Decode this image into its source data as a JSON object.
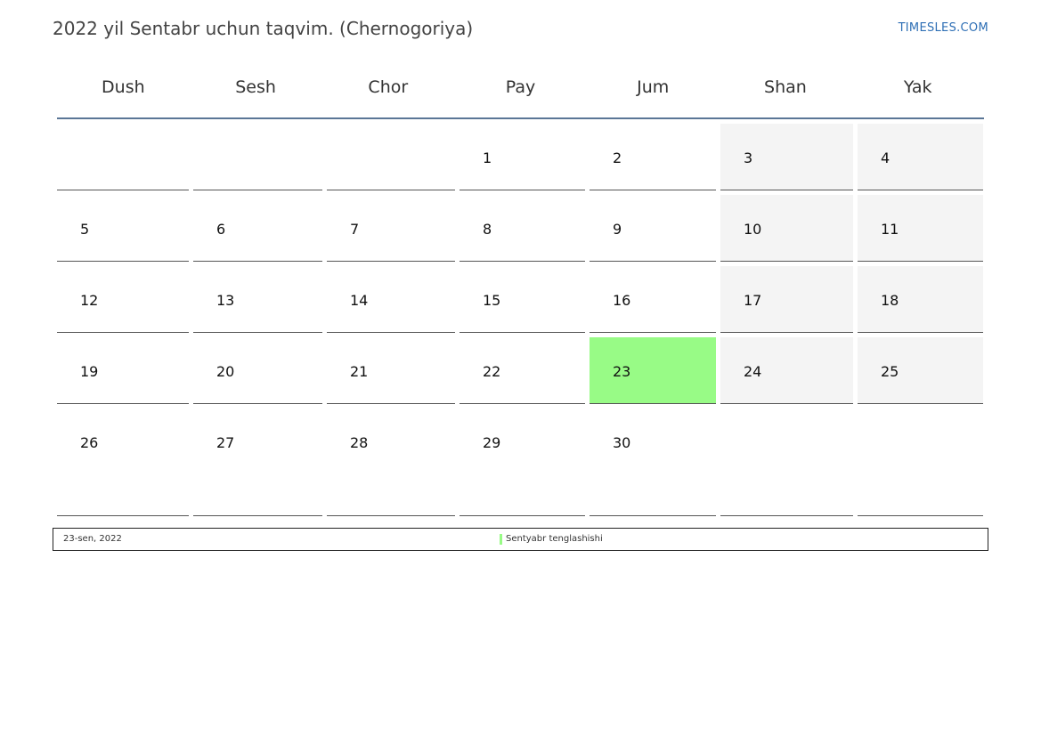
{
  "header": {
    "title": "2022 yil Sentabr uchun taqvim. (Chernogoriya)",
    "site": "TIMESLES.COM"
  },
  "calendar": {
    "weekdays": [
      "Dush",
      "Sesh",
      "Chor",
      "Pay",
      "Jum",
      "Shan",
      "Yak"
    ],
    "weeks": [
      [
        "",
        "",
        "",
        "1",
        "2",
        "3",
        "4"
      ],
      [
        "5",
        "6",
        "7",
        "8",
        "9",
        "10",
        "11"
      ],
      [
        "12",
        "13",
        "14",
        "15",
        "16",
        "17",
        "18"
      ],
      [
        "19",
        "20",
        "21",
        "22",
        "23",
        "24",
        "25"
      ],
      [
        "26",
        "27",
        "28",
        "29",
        "30",
        "",
        ""
      ]
    ],
    "holiday_day": "23",
    "colors": {
      "weekend": "#f4f4f4",
      "holiday": "#98fb86",
      "header_rule": "#5b7696",
      "link": "#2e6fb5"
    }
  },
  "legend": {
    "date": "23-sen, 2022",
    "name": "Sentyabr tenglashishi"
  }
}
